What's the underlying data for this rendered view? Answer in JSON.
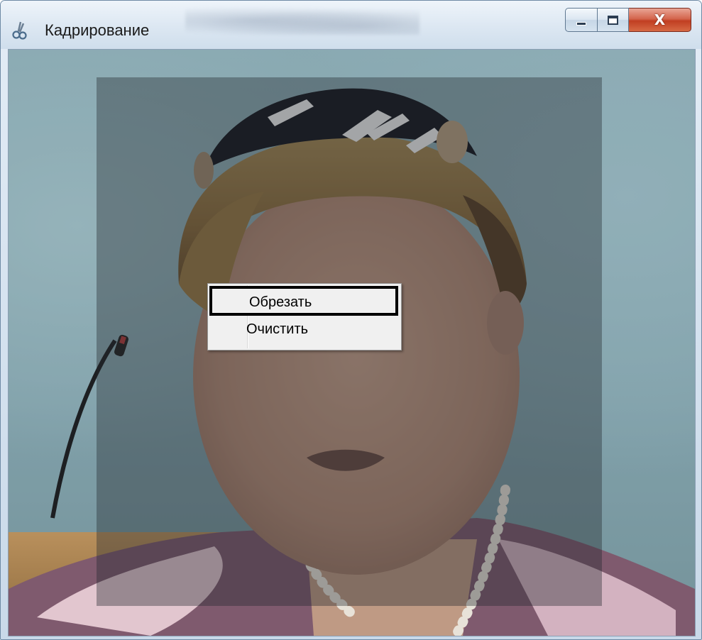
{
  "window": {
    "title": "Кадрирование",
    "app_icon": "scissors-icon",
    "controls": {
      "minimize_icon": "minimize-icon",
      "maximize_icon": "maximize-icon",
      "close_label": "X"
    }
  },
  "context_menu": {
    "items": [
      {
        "label": "Обрезать",
        "selected": true
      },
      {
        "label": "Очистить",
        "selected": false
      }
    ]
  }
}
